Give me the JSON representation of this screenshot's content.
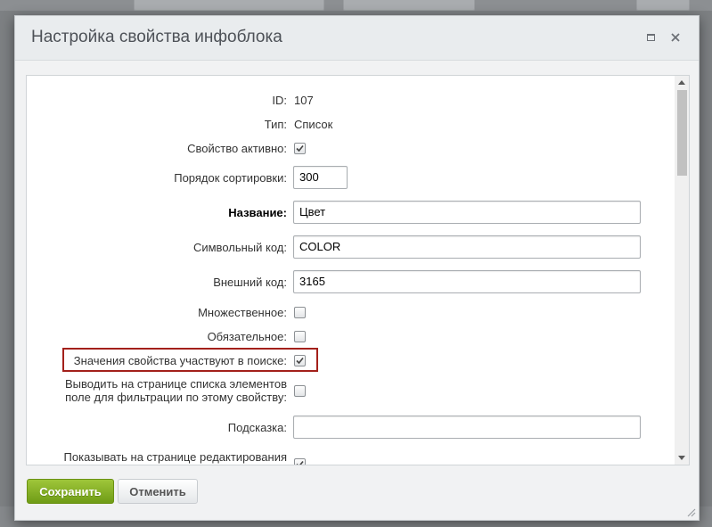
{
  "dialog": {
    "title": "Настройка свойства инфоблока",
    "maximize_icon": "maximize-icon",
    "close_icon": "close-icon"
  },
  "fields": {
    "id": {
      "label": "ID:",
      "value": "107"
    },
    "type": {
      "label": "Тип:",
      "value": "Список"
    },
    "active": {
      "label": "Свойство активно:",
      "checked": true
    },
    "sort": {
      "label": "Порядок сортировки:",
      "value": "300"
    },
    "name": {
      "label": "Название:",
      "value": "Цвет"
    },
    "code": {
      "label": "Символьный код:",
      "value": "COLOR"
    },
    "xml_id": {
      "label": "Внешний код:",
      "value": "3165"
    },
    "multiple": {
      "label": "Множественное:",
      "checked": false
    },
    "required": {
      "label": "Обязательное:",
      "checked": false
    },
    "searchable": {
      "label": "Значения свойства участвуют в поиске:",
      "checked": true
    },
    "filtrable": {
      "label": "Выводить на странице списка элементов поле для фильтрации по этому свойству:",
      "checked": false
    },
    "hint": {
      "label": "Подсказка:",
      "value": ""
    },
    "show_edit": {
      "label": "Показывать на странице редактирования",
      "checked": true
    }
  },
  "buttons": {
    "save": "Сохранить",
    "cancel": "Отменить"
  },
  "colors": {
    "accent": "#7aa51e",
    "highlight_border": "#a3201b"
  }
}
